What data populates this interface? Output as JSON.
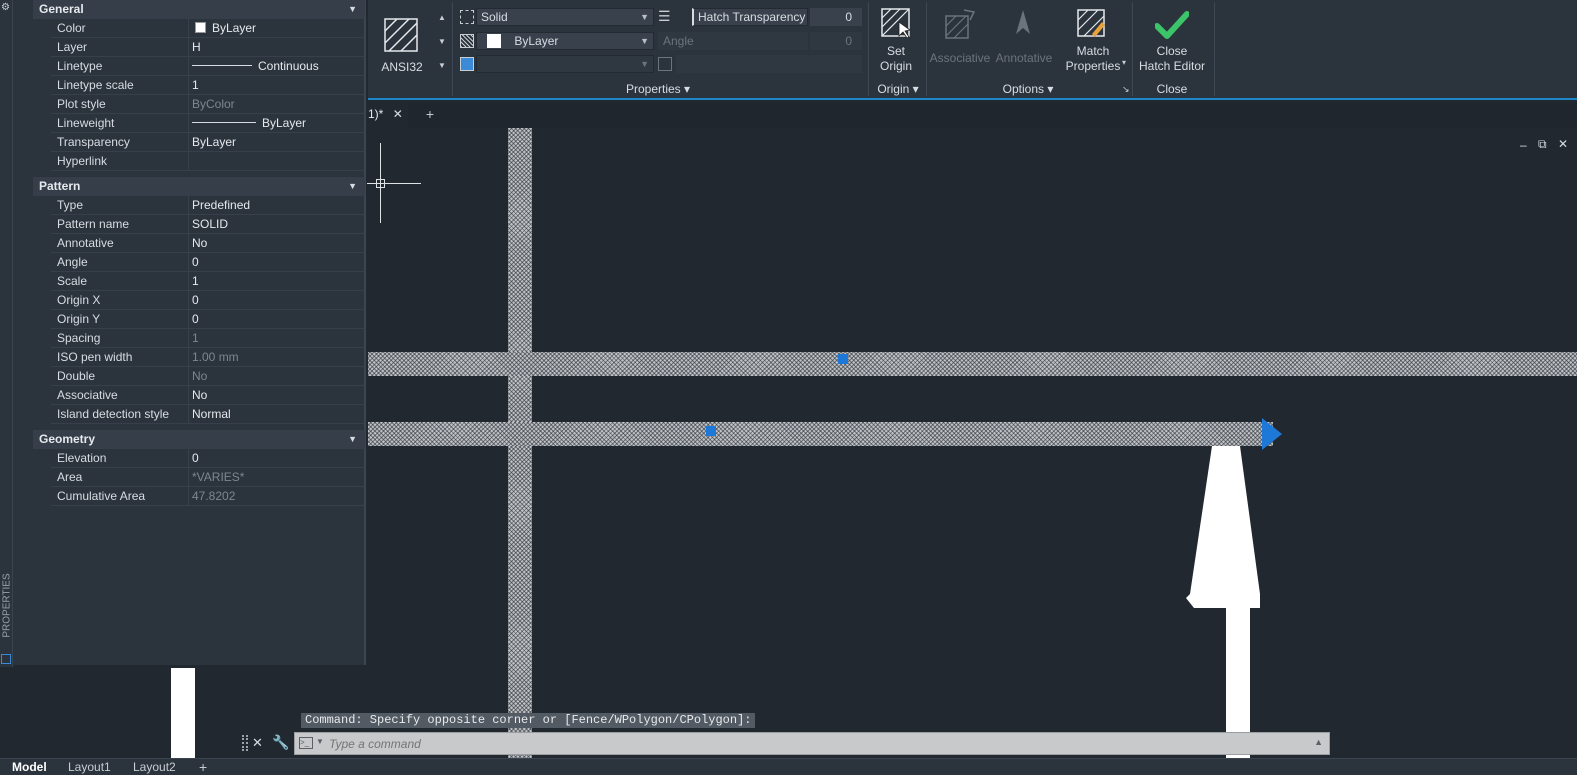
{
  "ribbon": {
    "hatch_pattern_name": "ANSI32",
    "hatch_type": "Solid",
    "hatch_color": "ByLayer",
    "background_color": "",
    "transparency_label": "Hatch Transparency",
    "transparency_value": "0",
    "angle_label": "Angle",
    "angle_value": "0",
    "scale_value": "",
    "properties_panel": "Properties",
    "set_origin_line1": "Set",
    "set_origin_line2": "Origin",
    "origin_panel": "Origin",
    "associative_label": "Associative",
    "annotative_label": "Annotative",
    "match_line1": "Match",
    "match_line2": "Properties",
    "options_panel": "Options",
    "close_line1": "Close",
    "close_line2": "Hatch Editor",
    "close_panel": "Close"
  },
  "doc_tab": {
    "label": "1)*"
  },
  "palette": {
    "strip_label": "PROPERTIES",
    "sections": {
      "general": "General",
      "pattern": "Pattern",
      "geometry": "Geometry"
    },
    "general": [
      {
        "name": "Color",
        "value": "ByLayer"
      },
      {
        "name": "Layer",
        "value": "H"
      },
      {
        "name": "Linetype",
        "value": "Continuous"
      },
      {
        "name": "Linetype scale",
        "value": "1"
      },
      {
        "name": "Plot style",
        "value": "ByColor"
      },
      {
        "name": "Lineweight",
        "value": "ByLayer"
      },
      {
        "name": "Transparency",
        "value": "ByLayer"
      },
      {
        "name": "Hyperlink",
        "value": ""
      }
    ],
    "pattern": [
      {
        "name": "Type",
        "value": "Predefined"
      },
      {
        "name": "Pattern name",
        "value": "SOLID"
      },
      {
        "name": "Annotative",
        "value": "No"
      },
      {
        "name": "Angle",
        "value": "0"
      },
      {
        "name": "Scale",
        "value": "1"
      },
      {
        "name": "Origin X",
        "value": "0"
      },
      {
        "name": "Origin Y",
        "value": "0"
      },
      {
        "name": "Spacing",
        "value": "1"
      },
      {
        "name": "ISO pen width",
        "value": "1.00 mm"
      },
      {
        "name": "Double",
        "value": "No"
      },
      {
        "name": "Associative",
        "value": "No"
      },
      {
        "name": "Island detection style",
        "value": "Normal"
      }
    ],
    "geometry": [
      {
        "name": "Elevation",
        "value": "0"
      },
      {
        "name": "Area",
        "value": "*VARIES*"
      },
      {
        "name": "Cumulative Area",
        "value": "47.8202"
      }
    ]
  },
  "command": {
    "history": "Command: Specify opposite corner or [Fence/WPolygon/CPolygon]:",
    "placeholder": "Type a command"
  },
  "layout_tabs": [
    "Model",
    "Layout1",
    "Layout2"
  ],
  "colors": {
    "accent": "#1c86c9",
    "grip": "#1e78d8",
    "checkmark": "#3cc46a"
  }
}
